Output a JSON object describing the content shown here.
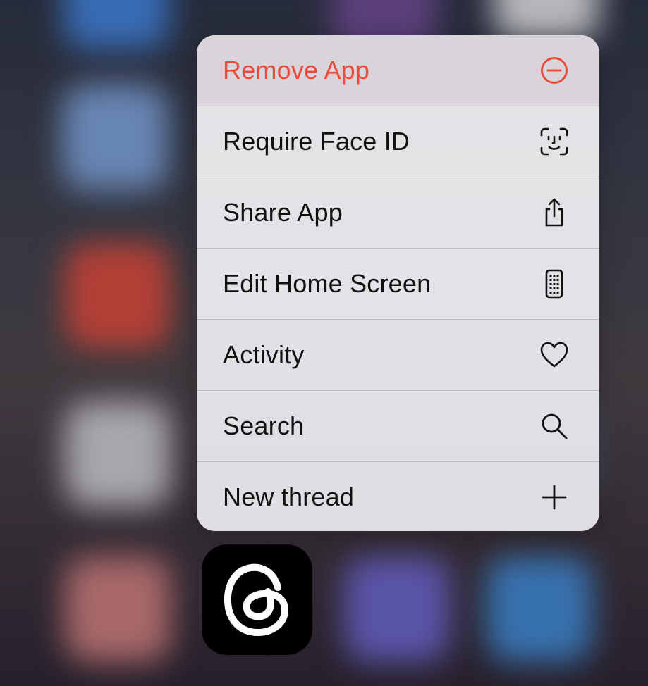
{
  "menu": {
    "items": [
      {
        "label": "Remove App",
        "icon": "minus-circle-icon",
        "destructive": true
      },
      {
        "label": "Require Face ID",
        "icon": "face-id-icon",
        "destructive": false
      },
      {
        "label": "Share App",
        "icon": "share-icon",
        "destructive": false
      },
      {
        "label": "Edit Home Screen",
        "icon": "phone-grid-icon",
        "destructive": false
      },
      {
        "label": "Activity",
        "icon": "heart-icon",
        "destructive": false
      },
      {
        "label": "Search",
        "icon": "magnifier-icon",
        "destructive": false
      },
      {
        "label": "New thread",
        "icon": "plus-icon",
        "destructive": false
      }
    ]
  },
  "app": {
    "icon": "threads-logo-icon"
  },
  "colors": {
    "destructive": "#ec4a3d",
    "text": "#111111",
    "app_icon_bg": "#000000"
  }
}
